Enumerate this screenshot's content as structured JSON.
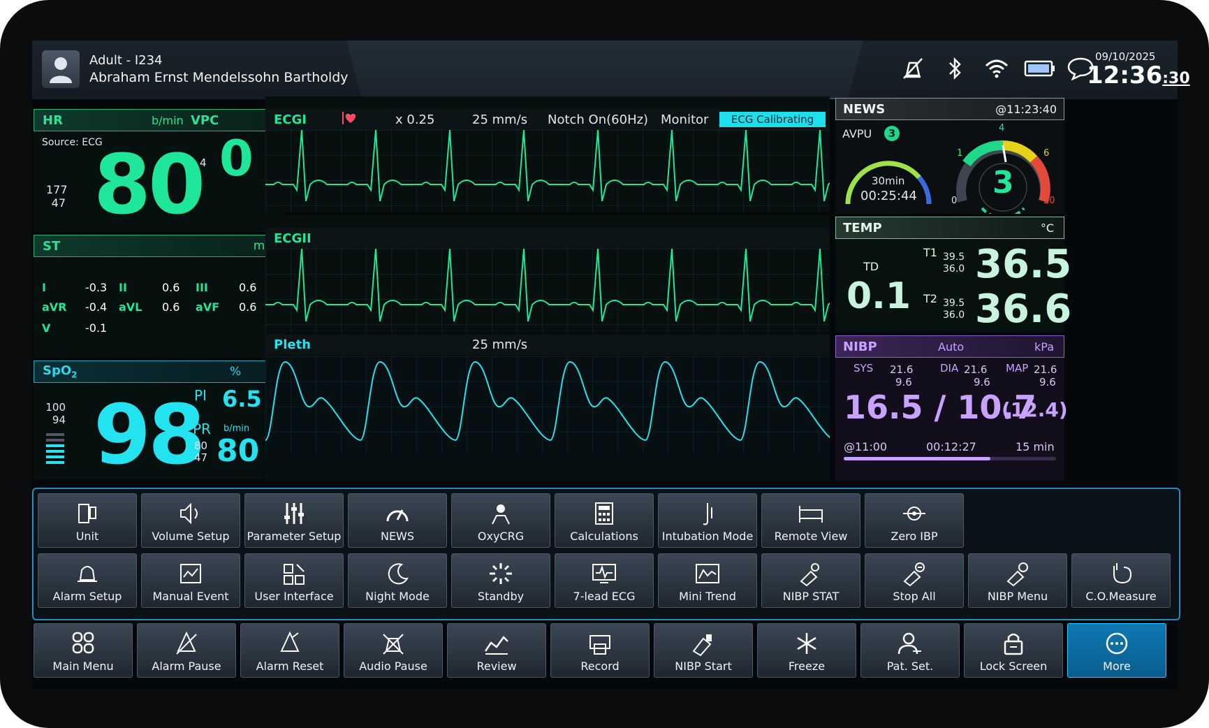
{
  "header": {
    "patient_type": "Adult - I234",
    "patient_name": "Abraham Ernst Mendelssohn Bartholdy",
    "date": "09/10/2025",
    "time": "12:36",
    "seconds": ":30",
    "status_icons": [
      "alarm-off-icon",
      "bluetooth-icon",
      "wifi-icon",
      "battery-icon",
      "message-icon"
    ]
  },
  "hr": {
    "title": "HR",
    "unit": "b/min",
    "vpc_label": "VPC",
    "source": "Source: ECG",
    "value": "80",
    "high": "177",
    "low": "47",
    "vpc_limit": "4",
    "vpc_value": "0"
  },
  "st": {
    "title": "ST",
    "unit": "mV",
    "leads": [
      {
        "label": "I",
        "value": "-0.3"
      },
      {
        "label": "II",
        "value": "0.6"
      },
      {
        "label": "III",
        "value": "0.6"
      },
      {
        "label": "aVR",
        "value": "-0.4"
      },
      {
        "label": "aVL",
        "value": "0.6"
      },
      {
        "label": "aVF",
        "value": "0.6"
      },
      {
        "label": "V",
        "value": "-0.1"
      }
    ]
  },
  "spo2": {
    "title": "SpO",
    "sub": "2",
    "unit": "%",
    "value": "98",
    "high": "100",
    "low": "94",
    "pi_label": "PI",
    "pi_value": "6.5",
    "pr_label": "PR",
    "pr_unit": "b/min",
    "pr_high": "80",
    "pr_low": "47",
    "pr_value": "80"
  },
  "ecg1": {
    "title": "ECGI",
    "gain": "x 0.25",
    "speed": "25 mm/s",
    "notch": "Notch On(60Hz)",
    "mode": "Monitor",
    "badge": "ECG Calibrating"
  },
  "ecg2": {
    "title": "ECGII"
  },
  "pleth": {
    "title": "Pleth",
    "speed": "25 mm/s"
  },
  "news": {
    "title": "NEWS",
    "time": "@11:23:40",
    "avpu_label": "AVPU",
    "avpu_value": "3",
    "timer_label": "30min",
    "timer_value": "00:25:44",
    "score": "3",
    "scale": [
      "0",
      "1",
      "4",
      "6",
      "20"
    ]
  },
  "temp": {
    "title": "TEMP",
    "unit": "°C",
    "td_label": "TD",
    "td_value": "0.1",
    "t1_label": "T1",
    "t1_high": "39.5",
    "t1_low": "36.0",
    "t1_value": "36.5",
    "t2_label": "T2",
    "t2_high": "39.5",
    "t2_low": "36.0",
    "t2_value": "36.6"
  },
  "nibp": {
    "title": "NIBP",
    "mode": "Auto",
    "unit": "kPa",
    "sys_label": "SYS",
    "sys_high": "21.6",
    "sys_low": "9.6",
    "dia_label": "DIA",
    "dia_high": "21.6",
    "dia_low": "9.6",
    "map_label": "MAP",
    "map_high": "21.6",
    "map_low": "9.6",
    "value": "16.5 / 10.7",
    "mean": "(12.4)",
    "last_time": "@11:00",
    "countdown": "00:12:27",
    "interval": "15 min",
    "progress": 0.69
  },
  "more_row1": [
    "Unit",
    "Volume Setup",
    "Parameter Setup",
    "NEWS",
    "OxyCRG",
    "Calculations",
    "Intubation Mode",
    "Remote View",
    "Zero IBP"
  ],
  "more_row2": [
    "Alarm Setup",
    "Manual Event",
    "User Interface",
    "Night Mode",
    "Standby",
    "7-lead ECG",
    "Mini Trend",
    "NIBP STAT",
    "Stop All",
    "NIBP Menu",
    "C.O.Measure"
  ],
  "bottom_row": [
    "Main Menu",
    "Alarm Pause",
    "Alarm Reset",
    "Audio Pause",
    "Review",
    "Record",
    "NIBP Start",
    "Freeze",
    "Pat. Set.",
    "Lock Screen",
    "More"
  ],
  "colors": {
    "green": "#1fe79a",
    "cyan": "#24e3f0",
    "purple": "#c9a2ff",
    "white": "#f2f4f6"
  }
}
